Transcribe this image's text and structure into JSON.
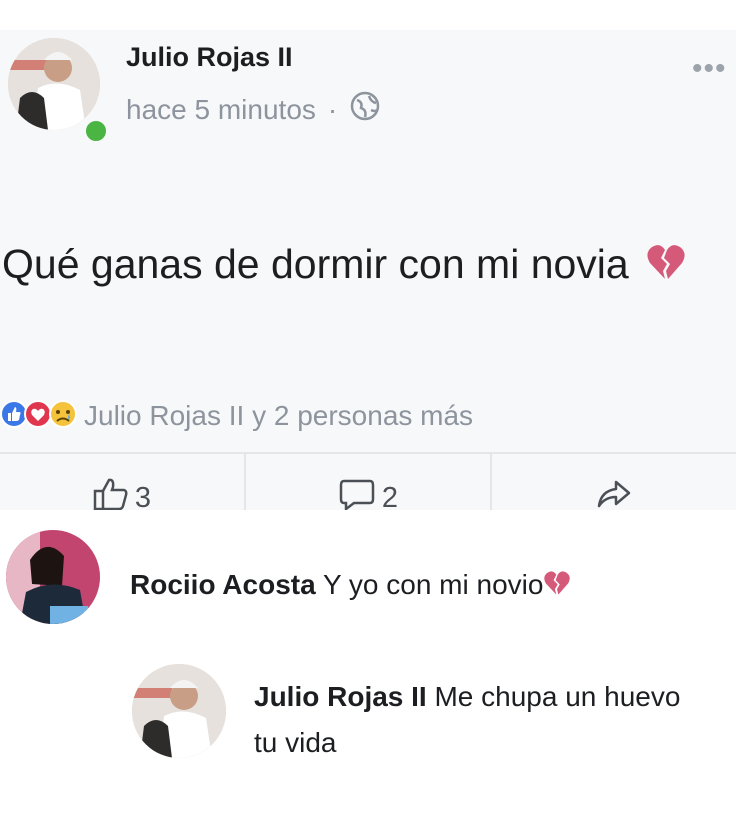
{
  "post": {
    "author": "Julio Rojas II",
    "timestamp": "hace 5 minutos",
    "separator": "·",
    "text": "Qué ganas de dormir con mi novia",
    "emoji_icon": "broken-heart-icon",
    "more_icon": "•••"
  },
  "reactions": {
    "icons": [
      "like-reaction-icon",
      "love-reaction-icon",
      "sad-reaction-icon"
    ],
    "summary": "Julio Rojas II y 2 personas más"
  },
  "actions": {
    "like_count": "3",
    "comment_count": "2"
  },
  "comments": [
    {
      "author": "Rociio Acosta",
      "text": "Y yo con mi novio",
      "emoji_icon": "broken-heart-icon"
    },
    {
      "author": "Julio Rojas II",
      "text": "Me chupa un huevo tu vida"
    }
  ],
  "colors": {
    "online": "#4bb543",
    "like_blue": "#3b78e7",
    "love_red": "#e0374e",
    "sad_yellow": "#f5c33b",
    "muted_text": "#8d949e"
  }
}
